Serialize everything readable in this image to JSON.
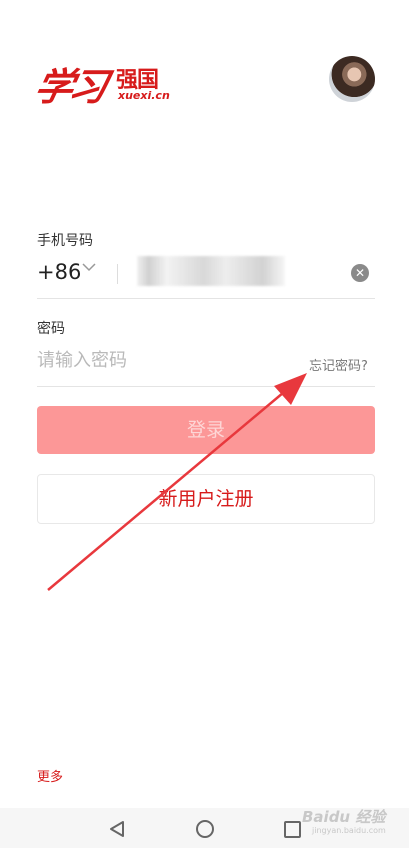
{
  "brand": {
    "logo_calligraphy": "学习",
    "logo_name": "强国",
    "logo_url": "xuexi.cn"
  },
  "phone": {
    "label": "手机号码",
    "country_code": "+86",
    "clear_glyph": "✕"
  },
  "password": {
    "label": "密码",
    "placeholder": "请输入密码",
    "forgot_link": "忘记密码?"
  },
  "buttons": {
    "login": "登录",
    "register": "新用户注册"
  },
  "footer": {
    "more": "更多"
  },
  "watermark": {
    "text": "Baidu 经验",
    "url": "jingyan.baidu.com"
  },
  "colors": {
    "brand_red": "#d71b1b",
    "login_button_disabled": "#fc9797",
    "annotation_arrow": "#e8383d"
  },
  "icons": {
    "country_dropdown": "chevron-down-icon",
    "clear": "close-circle-icon",
    "nav_back": "triangle-back-icon",
    "nav_home": "circle-home-icon",
    "nav_recent": "square-recent-icon"
  }
}
